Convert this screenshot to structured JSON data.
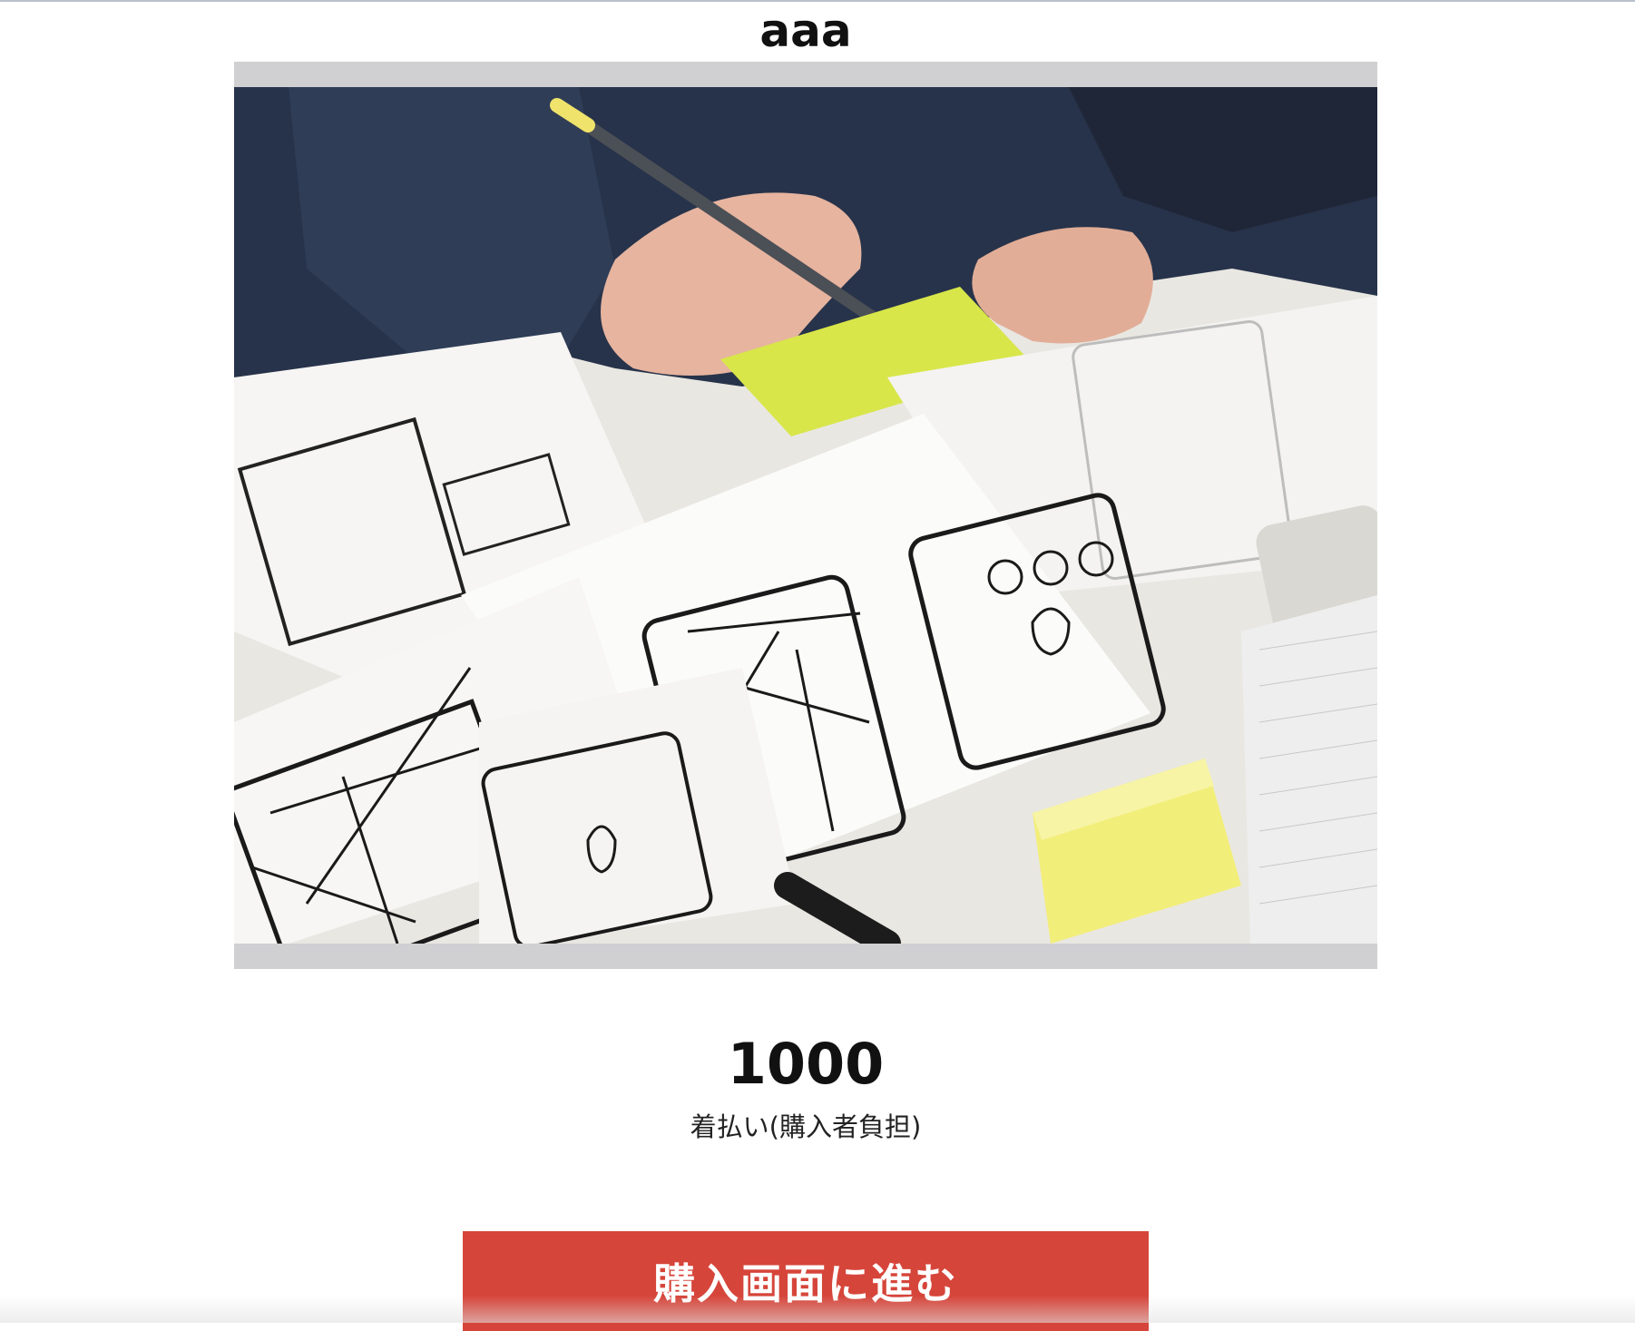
{
  "item": {
    "title": "aaa",
    "price": "1000",
    "shipping": "着払い(購入者負担)"
  },
  "photo": {
    "description_icon": "item-photo"
  },
  "actions": {
    "buy_label": "購入画面に進む"
  },
  "colors": {
    "button_background": "#d6453a",
    "frame_background": "#d0d0d3",
    "text": "#111111"
  }
}
